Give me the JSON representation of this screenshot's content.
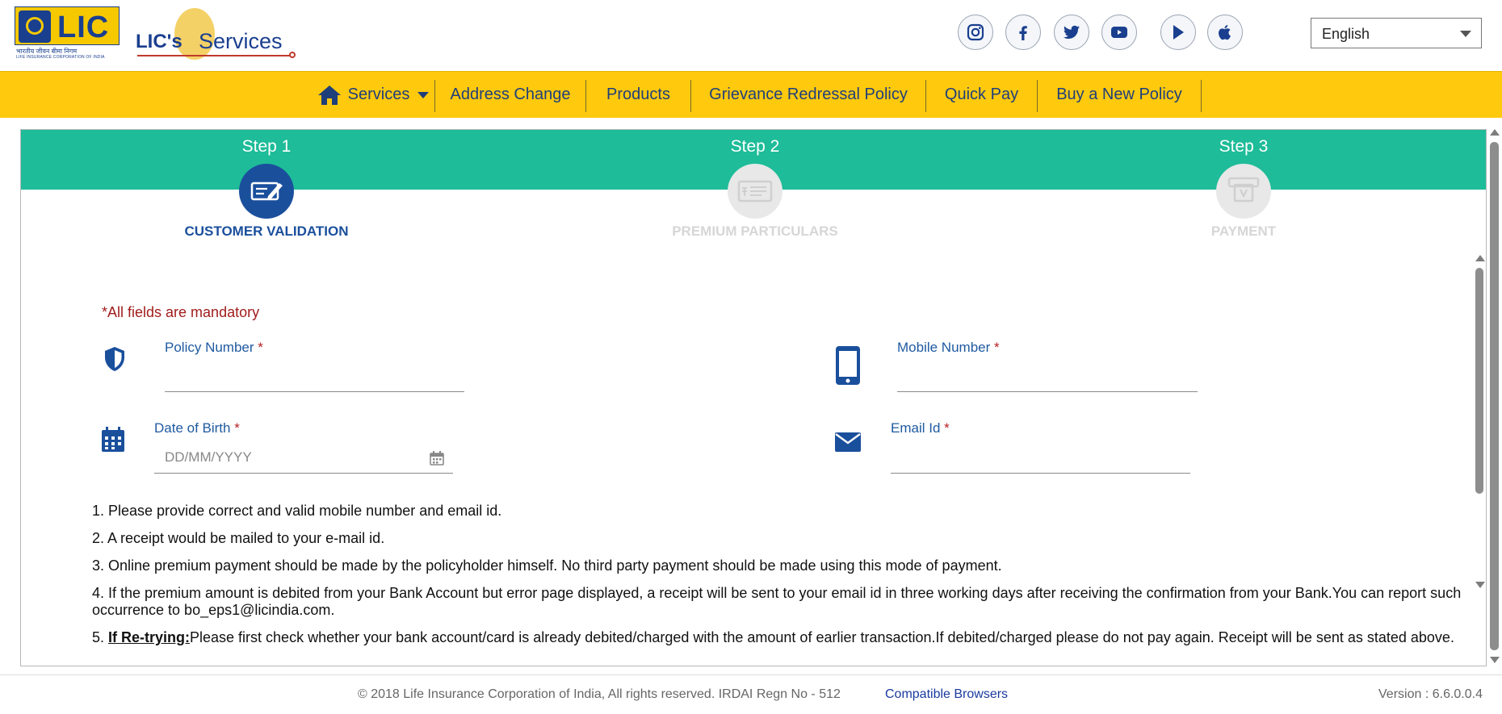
{
  "header": {
    "lic_logo_text": "LIC",
    "lic_hindi": "भारतीय जीवन बीमा निगम",
    "lic_corp": "LIFE INSURANCE CORPORATION OF INDIA",
    "eservices_prefix": "LIC's",
    "eservices_suffix": "Services",
    "social_icons": [
      "instagram-icon",
      "facebook-icon",
      "twitter-icon",
      "youtube-icon",
      "play-store-icon",
      "apple-icon"
    ],
    "language": "English"
  },
  "nav": {
    "items": [
      {
        "label": "Services",
        "icon": "home-icon",
        "dropdown": true
      },
      {
        "label": "Address Change"
      },
      {
        "label": "Products"
      },
      {
        "label": "Grievance Redressal Policy"
      },
      {
        "label": "Quick Pay"
      },
      {
        "label": "Buy a New Policy"
      }
    ]
  },
  "steps": [
    {
      "label": "Step 1",
      "caption": "CUSTOMER VALIDATION",
      "state": "active"
    },
    {
      "label": "Step 2",
      "caption": "PREMIUM PARTICULARS",
      "state": "inactive"
    },
    {
      "label": "Step 3",
      "caption": "PAYMENT",
      "state": "inactive"
    }
  ],
  "form": {
    "mandatory_note": "*All fields are mandatory",
    "policy_number": {
      "label": "Policy Number",
      "required": "*",
      "value": "",
      "placeholder": ""
    },
    "mobile_number": {
      "label": "Mobile Number",
      "required": "*",
      "value": "",
      "placeholder": ""
    },
    "dob": {
      "label": "Date of Birth",
      "required": "*",
      "value": "",
      "placeholder": "DD/MM/YYYY"
    },
    "email": {
      "label": "Email Id",
      "required": "*",
      "value": "",
      "placeholder": ""
    }
  },
  "notes": {
    "n1": "1. Please provide correct and valid mobile number and email id.",
    "n2": "2. A receipt would be mailed to your e-mail id.",
    "n3": "3. Online premium payment should be made by the policyholder himself. No third party payment should be made using this mode of payment.",
    "n4": "4. If the premium amount is debited from your Bank Account but error page displayed, a receipt will be sent to your email id in three working days after receiving the confirmation from your Bank.You can report such occurrence to bo_eps1@licindia.com.",
    "n5_prefix": "5. ",
    "n5_bold": "If Re-trying:",
    "n5_rest": "Please first check whether your bank account/card is already debited/charged with the amount of earlier transaction.If debited/charged please do not pay again. Receipt will be sent as stated above."
  },
  "footer": {
    "copyright": "© 2018 Life Insurance Corporation of India, All rights reserved. IRDAI Regn No - 512",
    "compatible_browsers": "Compatible Browsers",
    "version": "Version : 6.6.0.0.4"
  },
  "colors": {
    "nav_bg": "#ffc90e",
    "steps_band": "#1ebc99",
    "active_step": "#1a4f9c",
    "inactive_step": "#dcdcdc",
    "mandatory": "#a11d1d",
    "label_blue": "#1f5aa0"
  }
}
